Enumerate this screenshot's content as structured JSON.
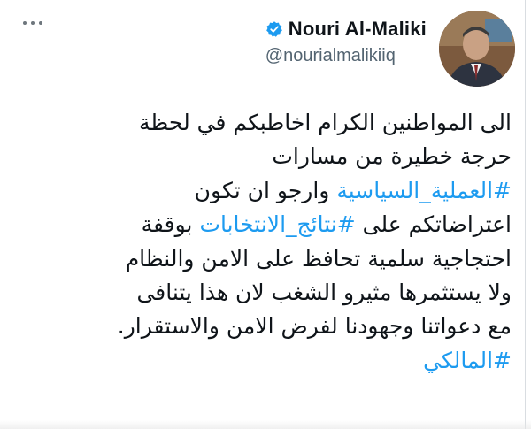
{
  "tweet": {
    "author": {
      "display_name": "Nouri Al-Maliki",
      "handle": "@nourialmalikiiq",
      "verified": true,
      "avatar_icon": "profile-photo"
    },
    "menu_icon": "more-horizontal-icon",
    "body": {
      "line1": "الى المواطنين الكرام اخاطبكم في لحظة",
      "line2": "حرجة خطيرة من مسارات",
      "line3_hashtag": "#العملية_السياسية",
      "line3_text": " وارجو ان تكون",
      "line4_text_start": "اعتراضاتكم على ",
      "line4_hashtag": "#نتائج_الانتخابات",
      "line4_text_end": " بوقفة",
      "line5": "احتجاجية سلمية تحافظ على الامن والنظام",
      "line6": "ولا يستثمرها مثيرو الشغب لان هذا يتنافى",
      "line7": "مع دعواتنا وجهودنا لفرض الامن والاستقرار.",
      "line8_hashtag": "#المالكي"
    }
  },
  "colors": {
    "hashtag": "#1d9bf0",
    "verified": "#1d9bf0",
    "text": "#0f1419",
    "secondary": "#536471"
  }
}
